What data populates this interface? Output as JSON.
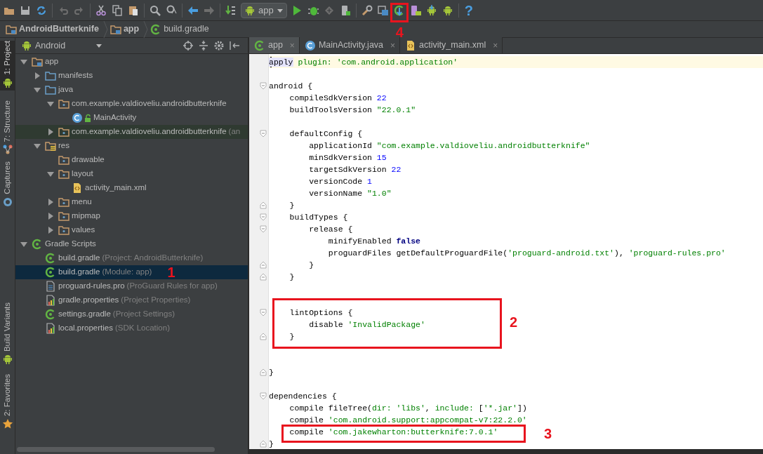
{
  "toolbar": {
    "run_config": "app",
    "help": "?"
  },
  "breadcrumbs": [
    {
      "label": "AndroidButterknife",
      "kind": "module"
    },
    {
      "label": "app",
      "kind": "module"
    },
    {
      "label": "build.gradle",
      "kind": "gradle"
    }
  ],
  "tool_strip": [
    {
      "label": "1: Project",
      "selected": true
    },
    {
      "label": "7: Structure",
      "selected": false
    },
    {
      "label": "Captures",
      "selected": false
    },
    {
      "label": "Build Variants",
      "selected": false
    },
    {
      "label": "2: Favorites",
      "selected": false
    }
  ],
  "project_panel": {
    "view": "Android",
    "tree": [
      {
        "label": "app",
        "kind": "module",
        "expanded": true,
        "selected": false,
        "highlighted": false,
        "children": [
          {
            "label": "manifests",
            "kind": "folder",
            "expanded": false,
            "selected": false,
            "highlighted": false
          },
          {
            "label": "java",
            "kind": "folder",
            "expanded": true,
            "selected": false,
            "highlighted": false,
            "children": [
              {
                "label": "com.example.valdioveliu.androidbutterknife",
                "kind": "package",
                "expanded": true,
                "selected": false,
                "highlighted": false,
                "children": [
                  {
                    "label": "MainActivity",
                    "kind": "class",
                    "selected": false,
                    "highlighted": false
                  }
                ]
              },
              {
                "label": "com.example.valdioveliu.androidbutterknife",
                "hint": "(an",
                "kind": "package",
                "expanded": false,
                "selected": false,
                "highlighted": true
              }
            ]
          },
          {
            "label": "res",
            "kind": "res",
            "expanded": true,
            "selected": false,
            "highlighted": false,
            "children": [
              {
                "label": "drawable",
                "kind": "package",
                "selected": false,
                "highlighted": false
              },
              {
                "label": "layout",
                "kind": "package",
                "expanded": true,
                "selected": false,
                "highlighted": false,
                "children": [
                  {
                    "label": "activity_main.xml",
                    "kind": "xml",
                    "selected": false,
                    "highlighted": false
                  }
                ]
              },
              {
                "label": "menu",
                "kind": "package",
                "expanded": false,
                "selected": false,
                "highlighted": false
              },
              {
                "label": "mipmap",
                "kind": "package",
                "expanded": false,
                "selected": false,
                "highlighted": false
              },
              {
                "label": "values",
                "kind": "package",
                "expanded": false,
                "selected": false,
                "highlighted": false
              }
            ]
          }
        ]
      },
      {
        "label": "Gradle Scripts",
        "kind": "gradle",
        "expanded": true,
        "selected": false,
        "highlighted": false,
        "children": [
          {
            "label": "build.gradle",
            "hint": "(Project: AndroidButterknife)",
            "kind": "gradle",
            "selected": false,
            "highlighted": false
          },
          {
            "label": "build.gradle",
            "hint": "(Module: app)",
            "kind": "gradle",
            "selected": true,
            "highlighted": false
          },
          {
            "label": "proguard-rules.pro",
            "hint": "(ProGuard Rules for app)",
            "kind": "proguard",
            "selected": false,
            "highlighted": false
          },
          {
            "label": "gradle.properties",
            "hint": "(Project Properties)",
            "kind": "properties",
            "selected": false,
            "highlighted": false
          },
          {
            "label": "settings.gradle",
            "hint": "(Project Settings)",
            "kind": "gradle",
            "selected": false,
            "highlighted": false
          },
          {
            "label": "local.properties",
            "hint": "(SDK Location)",
            "kind": "properties",
            "selected": false,
            "highlighted": false
          }
        ]
      }
    ]
  },
  "editor_tabs": [
    {
      "label": "app",
      "kind": "gradle",
      "selected": true,
      "close": "×"
    },
    {
      "label": "MainActivity.java",
      "kind": "class",
      "selected": false,
      "close": "×"
    },
    {
      "label": "activity_main.xml",
      "kind": "xml",
      "selected": false,
      "close": "×"
    }
  ],
  "code_lines": [
    {
      "current": true,
      "segments": [
        {
          "text": "apply",
          "kind": "highlight"
        },
        {
          "text": " plugin: 'com.android.application'",
          "kind": "string"
        }
      ]
    },
    {
      "current": false
    },
    {
      "current": false,
      "fold_start": true,
      "segments": [
        {
          "text": "android {",
          "kind": "plain"
        }
      ]
    },
    {
      "current": false,
      "segments": [
        {
          "text": "    compileSdkVersion ",
          "kind": "plain"
        },
        {
          "text": "22",
          "kind": "number"
        }
      ]
    },
    {
      "current": false,
      "segments": [
        {
          "text": "    buildToolsVersion ",
          "kind": "plain"
        },
        {
          "text": "\"22.0.1\"",
          "kind": "string"
        }
      ]
    },
    {
      "current": false
    },
    {
      "current": false,
      "fold_start": true,
      "segments": [
        {
          "text": "    defaultConfig {",
          "kind": "plain"
        }
      ]
    },
    {
      "current": false,
      "segments": [
        {
          "text": "        applicationId ",
          "kind": "plain"
        },
        {
          "text": "\"com.example.valdioveliu.androidbutterknife\"",
          "kind": "string"
        }
      ]
    },
    {
      "current": false,
      "segments": [
        {
          "text": "        minSdkVersion ",
          "kind": "plain"
        },
        {
          "text": "15",
          "kind": "number"
        }
      ]
    },
    {
      "current": false,
      "segments": [
        {
          "text": "        targetSdkVersion ",
          "kind": "plain"
        },
        {
          "text": "22",
          "kind": "number"
        }
      ]
    },
    {
      "current": false,
      "segments": [
        {
          "text": "        versionCode ",
          "kind": "plain"
        },
        {
          "text": "1",
          "kind": "number"
        }
      ]
    },
    {
      "current": false,
      "segments": [
        {
          "text": "        versionName ",
          "kind": "plain"
        },
        {
          "text": "\"1.0\"",
          "kind": "string"
        }
      ]
    },
    {
      "current": false,
      "fold_end": true,
      "segments": [
        {
          "text": "    }",
          "kind": "plain"
        }
      ]
    },
    {
      "current": false,
      "fold_start": true,
      "segments": [
        {
          "text": "    buildTypes {",
          "kind": "plain"
        }
      ]
    },
    {
      "current": false,
      "fold_start": true,
      "segments": [
        {
          "text": "        release {",
          "kind": "plain"
        }
      ]
    },
    {
      "current": false,
      "segments": [
        {
          "text": "            minifyEnabled ",
          "kind": "plain"
        },
        {
          "text": "false",
          "kind": "keyword"
        }
      ]
    },
    {
      "current": false,
      "segments": [
        {
          "text": "            proguardFiles getDefaultProguardFile(",
          "kind": "plain"
        },
        {
          "text": "'proguard-android.txt'",
          "kind": "string"
        },
        {
          "text": "), ",
          "kind": "plain"
        },
        {
          "text": "'proguard-rules.pro'",
          "kind": "string"
        }
      ]
    },
    {
      "current": false,
      "fold_end": true,
      "segments": [
        {
          "text": "        }",
          "kind": "plain"
        }
      ]
    },
    {
      "current": false,
      "fold_end": true,
      "segments": [
        {
          "text": "    }",
          "kind": "plain"
        }
      ]
    },
    {
      "current": false
    },
    {
      "current": false
    },
    {
      "current": false,
      "fold_start": true,
      "segments": [
        {
          "text": "    lintOptions {",
          "kind": "plain"
        }
      ]
    },
    {
      "current": false,
      "segments": [
        {
          "text": "        disable ",
          "kind": "plain"
        },
        {
          "text": "'InvalidPackage'",
          "kind": "string"
        }
      ]
    },
    {
      "current": false,
      "fold_end": true,
      "segments": [
        {
          "text": "    }",
          "kind": "plain"
        }
      ]
    },
    {
      "current": false
    },
    {
      "current": false
    },
    {
      "current": false,
      "fold_end": true,
      "segments": [
        {
          "text": "}",
          "kind": "plain"
        }
      ]
    },
    {
      "current": false
    },
    {
      "current": false,
      "fold_start": true,
      "segments": [
        {
          "text": "dependencies {",
          "kind": "plain"
        }
      ]
    },
    {
      "current": false,
      "segments": [
        {
          "text": "    compile fileTree(",
          "kind": "plain"
        },
        {
          "text": "dir: 'libs'",
          "kind": "string"
        },
        {
          "text": ", ",
          "kind": "plain"
        },
        {
          "text": "include: ",
          "kind": "string"
        },
        {
          "text": "[",
          "kind": "plain"
        },
        {
          "text": "'*.jar'",
          "kind": "string"
        },
        {
          "text": "])",
          "kind": "plain"
        }
      ]
    },
    {
      "current": false,
      "segments": [
        {
          "text": "    compile ",
          "kind": "plain"
        },
        {
          "text": "'com.android.support:appcompat-v7:22.2.0'",
          "kind": "string"
        }
      ]
    },
    {
      "current": false,
      "segments": [
        {
          "text": "    compile ",
          "kind": "plain"
        },
        {
          "text": "'com.jakewharton:butterknife:7.0.1'",
          "kind": "string"
        }
      ]
    },
    {
      "current": false,
      "fold_end": true,
      "segments": [
        {
          "text": "}",
          "kind": "plain"
        }
      ]
    }
  ],
  "annotations": [
    {
      "label": "4",
      "boxed": true
    },
    {
      "label": "1",
      "boxed": false
    },
    {
      "label": "2",
      "boxed": true
    },
    {
      "label": "3",
      "boxed": true
    }
  ]
}
